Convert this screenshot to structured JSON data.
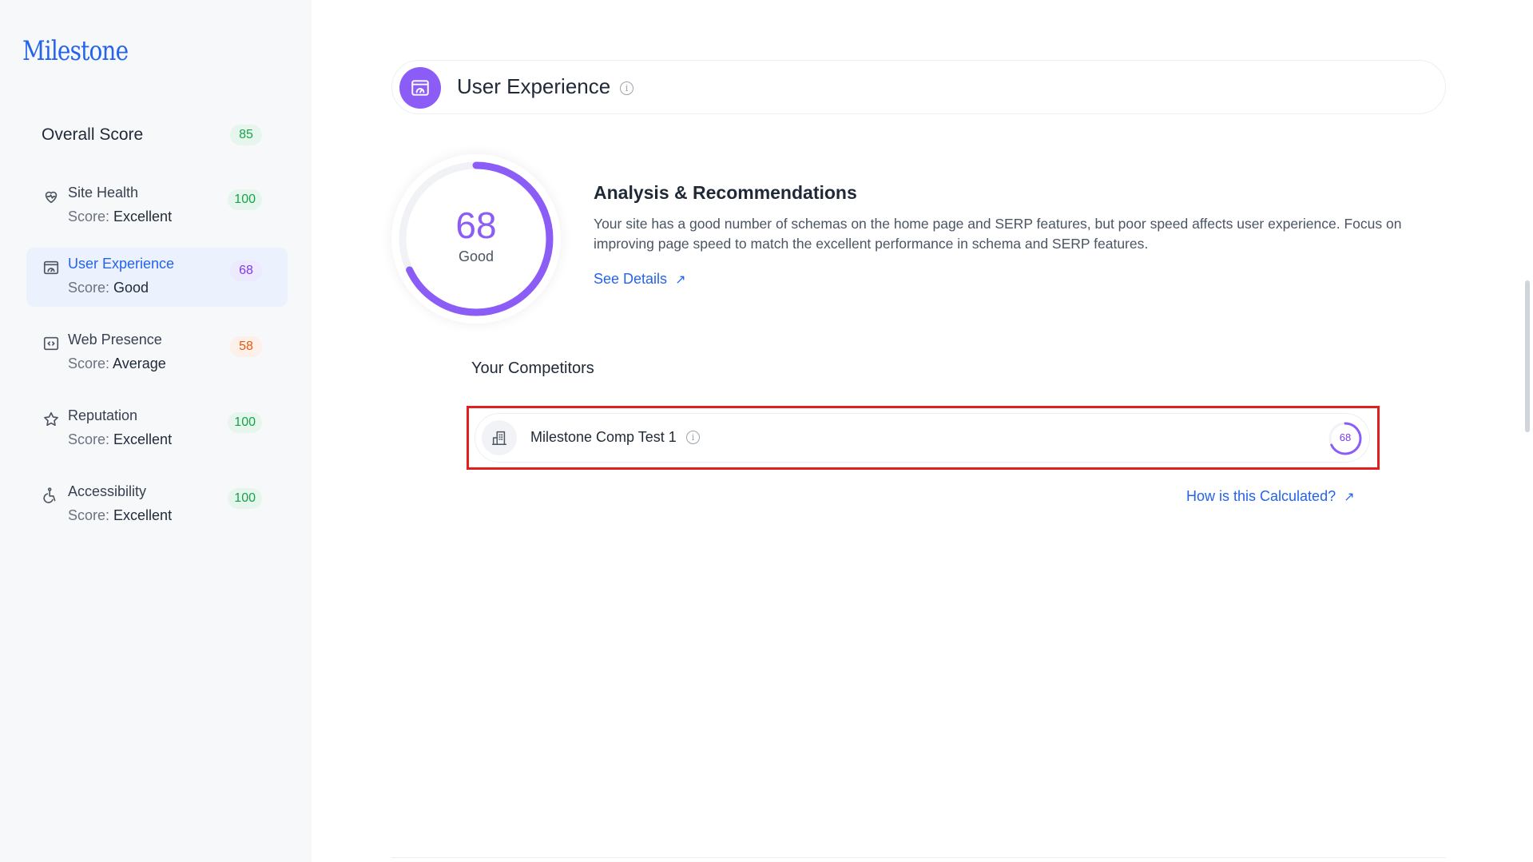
{
  "app": {
    "logo": "Milestone"
  },
  "sidebar": {
    "overall": {
      "label": "Overall Score",
      "value": "85"
    },
    "items": [
      {
        "icon": "heart-pulse-icon",
        "title": "Site Health",
        "score_prefix": "Score: ",
        "score_text": "Excellent",
        "value": "100",
        "color": "green"
      },
      {
        "icon": "speedometer-window-icon",
        "title": "User Experience",
        "score_prefix": "Score: ",
        "score_text": "Good",
        "value": "68",
        "color": "purple",
        "active": true
      },
      {
        "icon": "code-icon",
        "title": "Web Presence",
        "score_prefix": "Score: ",
        "score_text": "Average",
        "value": "58",
        "color": "orange"
      },
      {
        "icon": "star-icon",
        "title": "Reputation",
        "score_prefix": "Score: ",
        "score_text": "Excellent",
        "value": "100",
        "color": "green"
      },
      {
        "icon": "accessibility-icon",
        "title": "Accessibility",
        "score_prefix": "Score: ",
        "score_text": "Excellent",
        "value": "100",
        "color": "green"
      }
    ]
  },
  "main": {
    "header": {
      "title": "User Experience",
      "icon": "speedometer-window-icon"
    },
    "gauge": {
      "value": "68",
      "label": "Good",
      "fraction": 0.68,
      "color": "#8b5cf6"
    },
    "analysis": {
      "title": "Analysis & Recommendations",
      "text": "Your site has a good number of schemas on the home page and SERP features, but poor speed affects user experience. Focus on improving page speed to match the excellent performance in schema and SERP features.",
      "link": "See Details"
    },
    "competitors": {
      "title": "Your Competitors",
      "items": [
        {
          "name": "Milestone Comp Test 1",
          "score": "68",
          "fraction": 0.68
        }
      ]
    },
    "how_link": "How is this Calculated?"
  },
  "colors": {
    "accent": "#2563eb",
    "purple": "#8b5cf6",
    "highlight": "#e11d1d"
  }
}
